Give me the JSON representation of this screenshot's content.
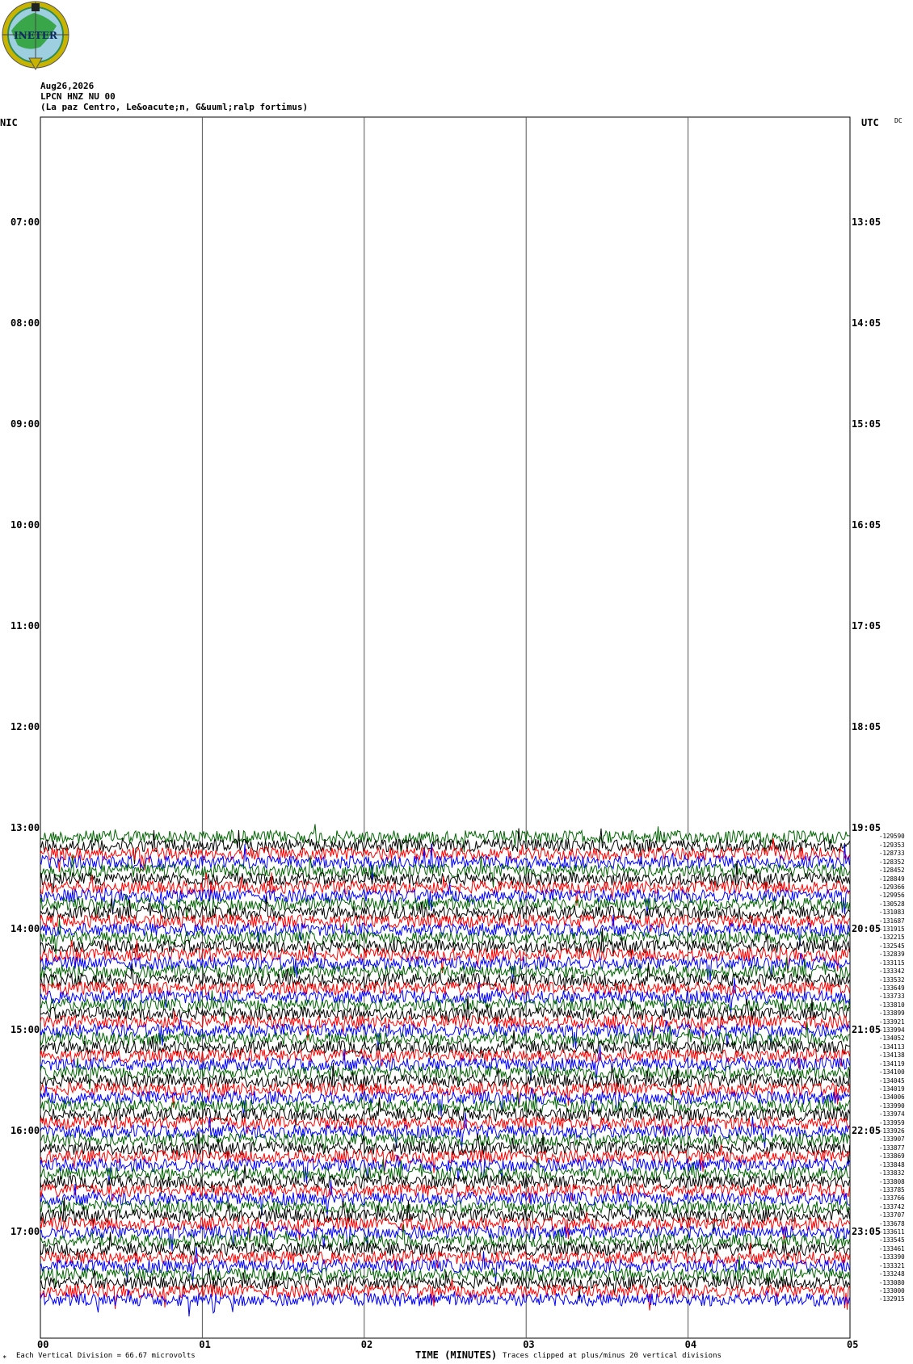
{
  "logo": {
    "text": "INETER",
    "colors": {
      "ring": "#2e8b57",
      "gold": "#c8b400",
      "land": "#3aa64a",
      "water": "#9ecfe0"
    }
  },
  "header": {
    "date": "Aug26,2026",
    "station": "LPCN HNZ NU 00",
    "location": "(La paz Centro, Le&oacute;n, G&uuml;ralp fortimus)"
  },
  "axes": {
    "left_label": "NIC",
    "right_label": "UTC",
    "dc_label": "DC",
    "left_times": [
      "07:00",
      "08:00",
      "09:00",
      "10:00",
      "11:00",
      "12:00",
      "13:00",
      "14:00",
      "15:00",
      "16:00",
      "17:00"
    ],
    "right_times": [
      "13:05",
      "14:05",
      "15:05",
      "16:05",
      "17:05",
      "18:05",
      "19:05",
      "20:05",
      "21:05",
      "22:05",
      "23:05"
    ],
    "x_ticks": [
      "00",
      "01",
      "02",
      "03",
      "04",
      "05"
    ]
  },
  "footer": {
    "division_label": "Each Vertical Division =",
    "division_value": "66.67 microvolts",
    "xlabel": "TIME (MINUTES)",
    "clip_note": "Traces clipped at plus/minus 20 vertical divisions"
  },
  "chart_data": {
    "type": "line",
    "x_range_minutes": [
      0,
      5
    ],
    "trace_interval_minutes": 5,
    "first_trace_nic": "13:05",
    "trace_colors": [
      "#006400",
      "#000000",
      "#ff0000",
      "#0000ff"
    ],
    "dc_offsets": [
      -129590,
      -129353,
      -128733,
      -128352,
      -128452,
      -128849,
      -129366,
      -129956,
      -130528,
      -131083,
      -131687,
      -131915,
      -132215,
      -132545,
      -132839,
      -133115,
      -133342,
      -133532,
      -133649,
      -133733,
      -133810,
      -133899,
      -133921,
      -133994,
      -134052,
      -134113,
      -134138,
      -134119,
      -134100,
      -134045,
      -134019,
      -134006,
      -133990,
      -133974,
      -133959,
      -133926,
      -133907,
      -133877,
      -133869,
      -133848,
      -133832,
      -133808,
      -133785,
      -133766,
      -133742,
      -133707,
      -133678,
      -133611,
      -133545,
      -133461,
      -133390,
      -133321,
      -133248,
      -133080,
      -133000,
      -132915
    ]
  }
}
